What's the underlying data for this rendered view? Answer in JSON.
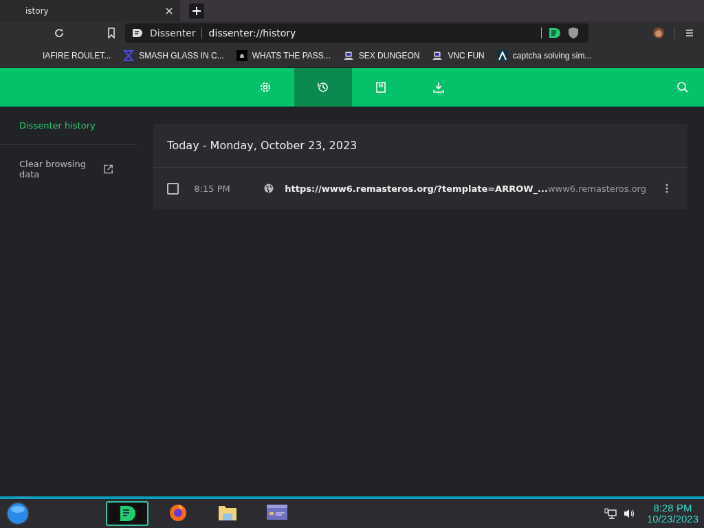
{
  "tab": {
    "title": "istory"
  },
  "address_bar": {
    "site_label": "Dissenter",
    "url": "dissenter://history"
  },
  "bookmarks": [
    {
      "label": "IAFIRE ROULET...",
      "kind": "none"
    },
    {
      "label": "SMASH GLASS IN C...",
      "kind": "sigma"
    },
    {
      "label": "WHATS THE PASS...",
      "kind": "dark"
    },
    {
      "label": "SEX DUNGEON",
      "kind": "pc"
    },
    {
      "label": "VNC FUN",
      "kind": "pc"
    },
    {
      "label": "captcha solving sim...",
      "kind": "lambda"
    }
  ],
  "nav_tabs": [
    {
      "kind": "settings",
      "selected": false
    },
    {
      "kind": "history",
      "selected": true
    },
    {
      "kind": "bookmarks",
      "selected": false
    },
    {
      "kind": "downloads",
      "selected": false
    }
  ],
  "sidebar": {
    "title": "Dissenter history",
    "items": [
      {
        "label": "Clear browsing data"
      }
    ]
  },
  "history": {
    "heading": "Today - Monday, October 23, 2023",
    "entries": [
      {
        "checked": false,
        "time": "8:15 PM",
        "url": "https://www6.remasteros.org/?template=ARROW_...",
        "domain": "www6.remasteros.org"
      }
    ]
  },
  "taskbar": {
    "apps": [
      {
        "kind": "dissenter",
        "selected": true
      },
      {
        "kind": "firefox",
        "selected": false
      },
      {
        "kind": "folder",
        "selected": false
      },
      {
        "kind": "card",
        "selected": false
      }
    ],
    "time": "8:28 PM",
    "date": "10/23/2023"
  }
}
